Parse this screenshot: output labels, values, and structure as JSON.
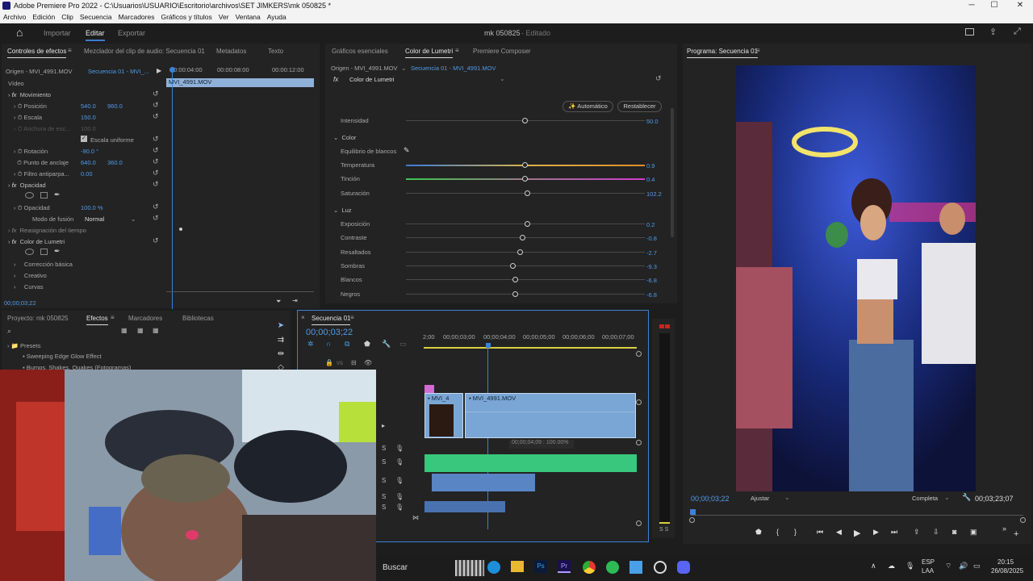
{
  "window": {
    "title": "Adobe Premiere Pro 2022 - C:\\Usuarios\\USUARIO\\Escritorio\\archivos\\SET JIMKERS\\mk 050825 *",
    "minimize": "─",
    "maximize": "☐",
    "close": "✕"
  },
  "menu": [
    "Archivo",
    "Edición",
    "Clip",
    "Secuencia",
    "Marcadores",
    "Gráficos y títulos",
    "Ver",
    "Ventana",
    "Ayuda"
  ],
  "workspace": {
    "home": "⌂",
    "tabs": [
      "Importar",
      "Editar",
      "Exportar"
    ],
    "project": "mk 050825",
    "status": "- Editado"
  },
  "effects_controls": {
    "tabs": [
      "Controles de efectos",
      "Mezclador del clip de audio: Secuencia 01",
      "Metadatos",
      "Texto"
    ],
    "source": "Origen - MVI_4991.MOV",
    "sequence": "Secuencia 01 - MVI_...",
    "ruler": [
      "00:00:04:00",
      "00:00:08:00",
      "00:00:12:00"
    ],
    "clip_name": "MVI_4991.MOV",
    "video_label": "Vídeo",
    "movimiento": "Movimiento",
    "posicion": {
      "label": "Posición",
      "x": "540.0",
      "y": "960.0"
    },
    "escala": {
      "label": "Escala",
      "value": "150.0"
    },
    "anchura": {
      "label": "Anchura de esc...",
      "value": "100.0"
    },
    "uniforme": "Escala uniforme",
    "rotacion": {
      "label": "Rotación",
      "value": "-90.0 °"
    },
    "anclaje": {
      "label": "Punto de anclaje",
      "x": "640.0",
      "y": "360.0"
    },
    "antiparpadeo": {
      "label": "Filtro antiparpa...",
      "value": "0.00"
    },
    "opacidad_sec": "Opacidad",
    "opacidad": {
      "label": "Opacidad",
      "value": "100.0 %"
    },
    "fusion": {
      "label": "Modo de fusión",
      "value": "Normal"
    },
    "resignacion": "Reasignación del tiempo",
    "lumetri": "Color de Lumetri",
    "sub": [
      "Corrección básica",
      "Creativo",
      "Curvas"
    ],
    "timecode": "00;00;03;22"
  },
  "lumetri": {
    "tabs": [
      "Gráficos esenciales",
      "Color de Lumetri",
      "Premiere Composer"
    ],
    "source": "Origen - MVI_4991.MOV",
    "sequence": "Secuencia 01 - MVI_4991.MOV",
    "effect": "Color de Lumetri",
    "auto": "Automático",
    "reset": "Restablecer",
    "intensidad": {
      "label": "Intensidad",
      "value": "50.0",
      "level": 0.5
    },
    "color_section": "Color",
    "balance": "Equilibrio de blancos",
    "temperatura": {
      "label": "Temperatura",
      "value": "0.9",
      "level": 0.5
    },
    "tincion": {
      "label": "Tinción",
      "value": "0.4",
      "level": 0.5
    },
    "saturacion": {
      "label": "Saturación",
      "value": "102.2",
      "level": 0.51
    },
    "luz_section": "Luz",
    "luz": [
      {
        "label": "Exposición",
        "value": "0.2",
        "level": 0.51
      },
      {
        "label": "Contraste",
        "value": "-0.8",
        "level": 0.49
      },
      {
        "label": "Resaltados",
        "value": "-2.7",
        "level": 0.48
      },
      {
        "label": "Sombras",
        "value": "-9.3",
        "level": 0.45
      },
      {
        "label": "Blancos",
        "value": "-6.8",
        "level": 0.46
      },
      {
        "label": "Negros",
        "value": "-6.8",
        "level": 0.46
      }
    ]
  },
  "program": {
    "title": "Programa: Secuencia 01",
    "timecode": "00;00;03;22",
    "fit": "Ajustar",
    "quality": "Completa",
    "duration": "00;03;23;07"
  },
  "project": {
    "tabs": [
      "Proyecto: mk 050825",
      "Efectos",
      "Marcadores",
      "Bibliotecas"
    ],
    "presets": "Presets",
    "items": [
      "Sweeping Edge Glow Effect",
      "Bumps, Shakes, Quakes (Fotogramas)"
    ]
  },
  "timeline": {
    "title": "Secuencia 01",
    "timecode": "00;00;03;22",
    "ruler": [
      "2;00",
      "00;00;03;00",
      "00;00;04;00",
      "00;00;05;00",
      "00;00;06;00",
      "00;00;07;00"
    ],
    "clip1": "MVI_4",
    "clip2": "MVI_4991.MOV",
    "tooltip": "00;00;04;09 : 100.00%",
    "v1": "V1",
    "track_labels": [
      "S",
      "S",
      "S",
      "S",
      "S"
    ]
  },
  "audio_meter": {
    "labels": "S S"
  },
  "taskbar": {
    "search": "Buscar",
    "lang1": "ESP",
    "lang2": "LAA",
    "time": "20:15",
    "date": "26/08/2025"
  },
  "colors": {
    "accent": "#3d7bd6",
    "value_blue": "#4f9be8",
    "audio_green": "#39c77d",
    "video_clip": "#7aa6d6",
    "playhead": "#3a82d8"
  }
}
